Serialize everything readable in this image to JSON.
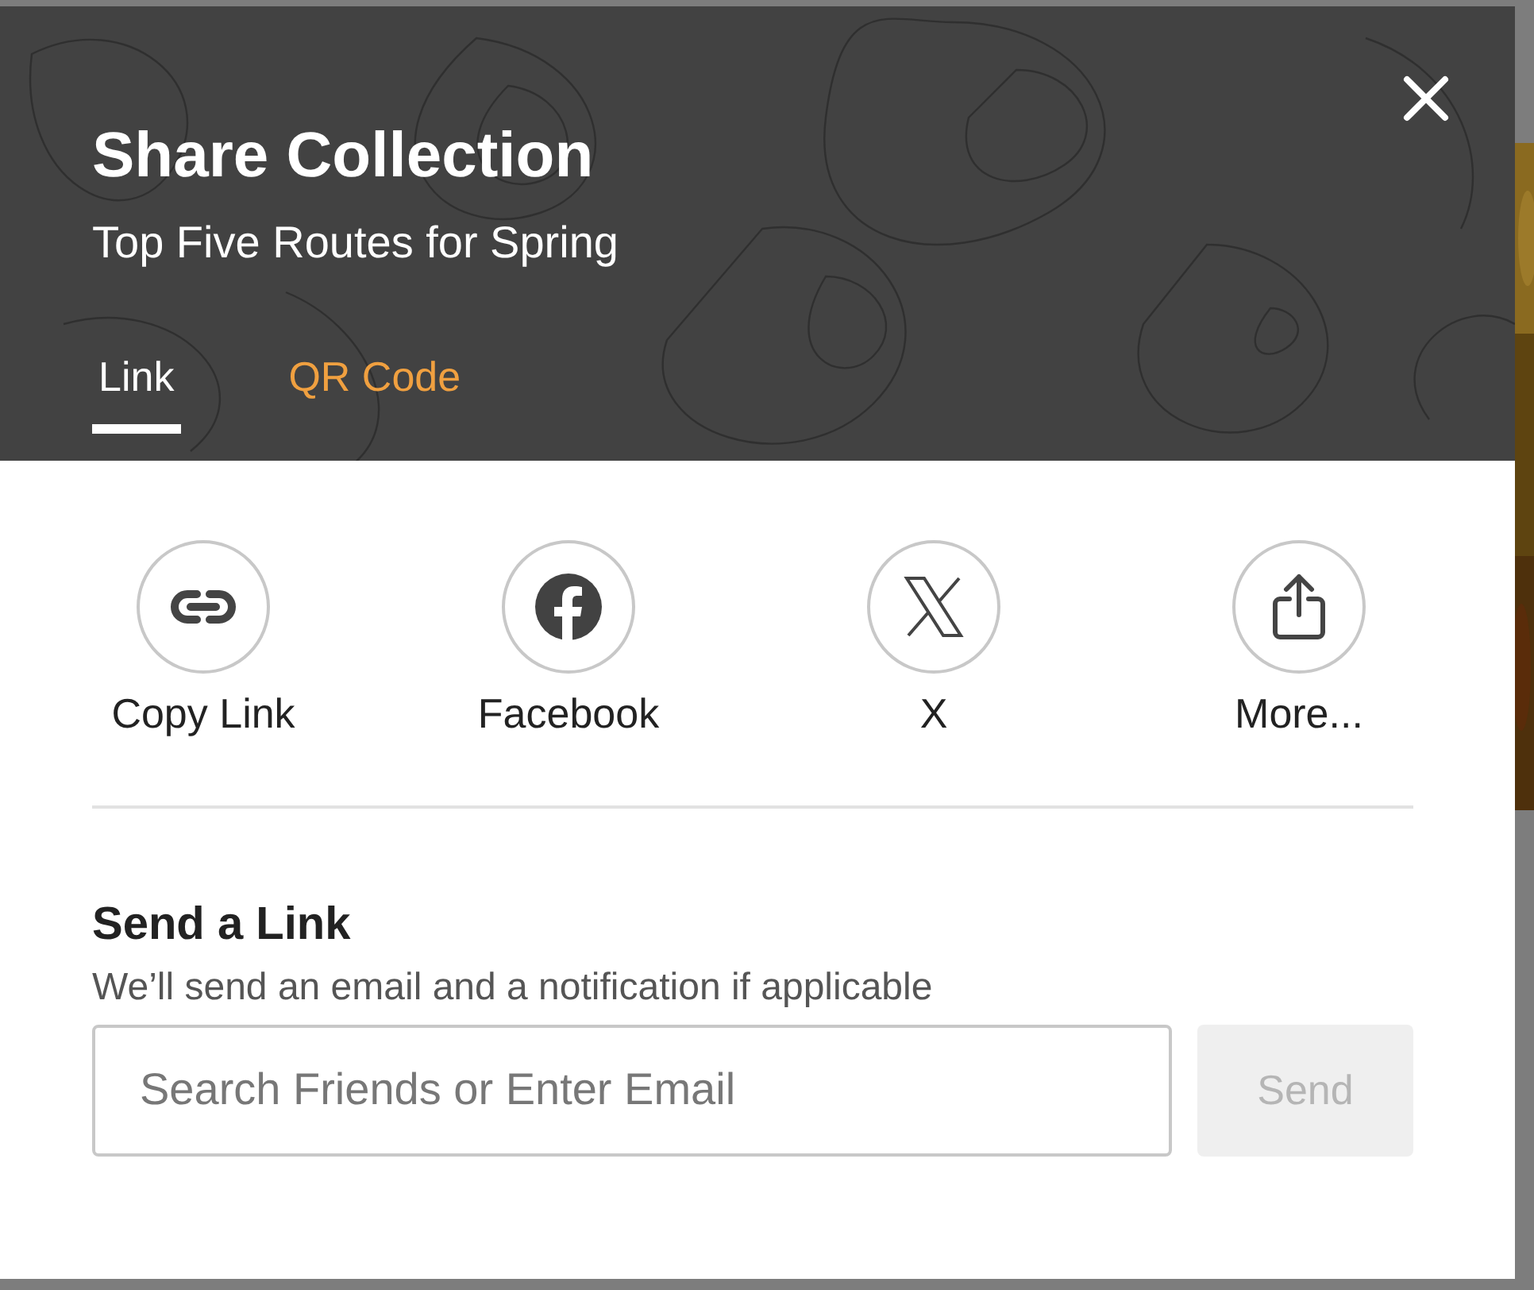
{
  "dialog": {
    "title": "Share Collection",
    "subtitle": "Top Five Routes for Spring"
  },
  "tabs": [
    {
      "label": "Link",
      "selected": true
    },
    {
      "label": "QR Code",
      "selected": false
    }
  ],
  "share_options": [
    {
      "kind": "link",
      "label": "Copy Link"
    },
    {
      "kind": "facebook",
      "label": "Facebook"
    },
    {
      "kind": "x",
      "label": "X"
    },
    {
      "kind": "more",
      "label": "More..."
    }
  ],
  "send_link": {
    "heading": "Send a Link",
    "description": "We’ll send an email and a notification if applicable",
    "placeholder": "Search Friends or Enter Email",
    "button": {
      "label": "Send",
      "disabled": true
    }
  }
}
